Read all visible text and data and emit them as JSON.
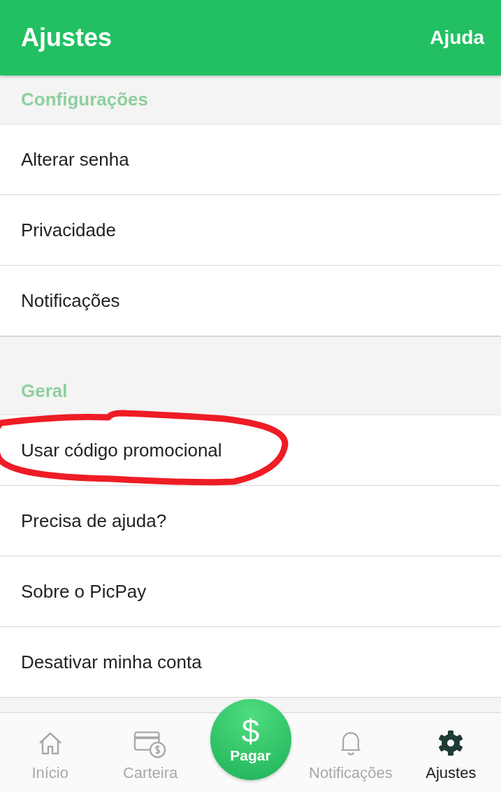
{
  "header": {
    "title": "Ajustes",
    "action": "Ajuda"
  },
  "sections": [
    {
      "title": "Configurações",
      "items": [
        {
          "label": "Alterar senha",
          "circled": false
        },
        {
          "label": "Privacidade",
          "circled": false
        },
        {
          "label": "Notificações",
          "circled": false
        }
      ]
    },
    {
      "title": "Geral",
      "items": [
        {
          "label": "Usar código promocional",
          "circled": true
        },
        {
          "label": "Precisa de ajuda?",
          "circled": false
        },
        {
          "label": "Sobre o PicPay",
          "circled": false
        },
        {
          "label": "Desativar minha conta",
          "circled": false
        }
      ]
    }
  ],
  "tab_bar": {
    "items": [
      {
        "kind": "home",
        "label": "Início",
        "selected": false
      },
      {
        "kind": "wallet",
        "label": "Carteira",
        "selected": false
      },
      {
        "kind": "pay",
        "symbol": "$",
        "label": "Pagar",
        "selected": false
      },
      {
        "kind": "bell",
        "label": "Notificações",
        "selected": false
      },
      {
        "kind": "gear",
        "label": "Ajustes",
        "selected": true
      }
    ]
  }
}
